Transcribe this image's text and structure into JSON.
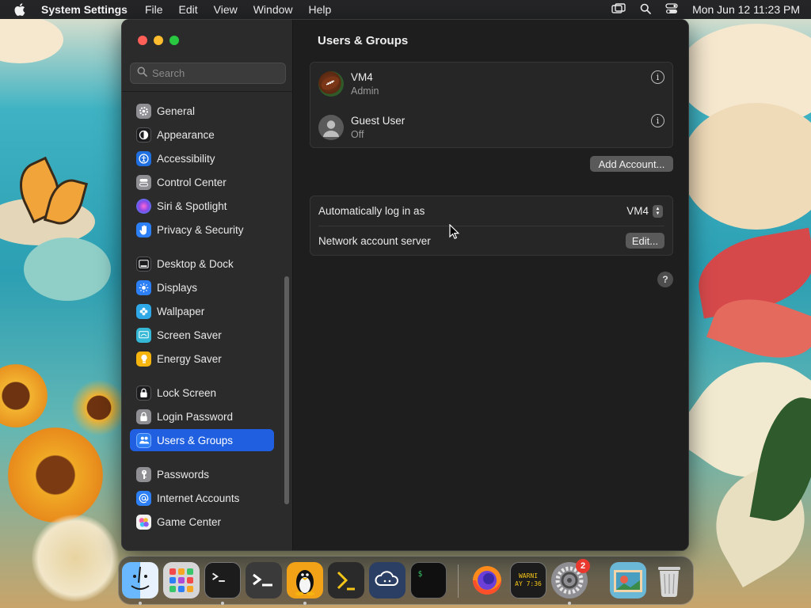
{
  "menubar": {
    "app_name": "System Settings",
    "menus": [
      "File",
      "Edit",
      "View",
      "Window",
      "Help"
    ],
    "clock": "Mon Jun 12  11:23 PM"
  },
  "sidebar": {
    "search_placeholder": "Search",
    "items": [
      {
        "label": "General",
        "icon": "gear-icon",
        "color": "#8e8e93"
      },
      {
        "label": "Appearance",
        "icon": "appearance-icon",
        "color": "#1c1c1e"
      },
      {
        "label": "Accessibility",
        "icon": "accessibility-icon",
        "color": "#1f6fe0"
      },
      {
        "label": "Control Center",
        "icon": "control-center-icon",
        "color": "#8e8e93"
      },
      {
        "label": "Siri & Spotlight",
        "icon": "siri-icon",
        "color": "#b04ad6"
      },
      {
        "label": "Privacy & Security",
        "icon": "hand-icon",
        "color": "#2d7ff5"
      },
      {
        "label": "Desktop & Dock",
        "icon": "dock-icon",
        "color": "#1c1c1e"
      },
      {
        "label": "Displays",
        "icon": "displays-icon",
        "color": "#2d7ff5"
      },
      {
        "label": "Wallpaper",
        "icon": "wallpaper-icon",
        "color": "#2fa8e8"
      },
      {
        "label": "Screen Saver",
        "icon": "screen-saver-icon",
        "color": "#35b7d6"
      },
      {
        "label": "Energy Saver",
        "icon": "battery-icon",
        "color": "#f5b50e"
      },
      {
        "label": "Lock Screen",
        "icon": "lock-icon",
        "color": "#1c1c1e"
      },
      {
        "label": "Login Password",
        "icon": "login-lock-icon",
        "color": "#8e8e93"
      },
      {
        "label": "Users & Groups",
        "icon": "users-icon",
        "color": "#2d7ff5",
        "active": true
      },
      {
        "label": "Passwords",
        "icon": "key-icon",
        "color": "#8e8e93"
      },
      {
        "label": "Internet Accounts",
        "icon": "at-icon",
        "color": "#2d7ff5"
      },
      {
        "label": "Game Center",
        "icon": "game-center-icon",
        "color": "#e8e8e8"
      }
    ]
  },
  "main": {
    "title": "Users & Groups",
    "users": [
      {
        "name": "VM4",
        "role": "Admin"
      },
      {
        "name": "Guest User",
        "role": "Off"
      }
    ],
    "add_account_label": "Add Account...",
    "auto_login_label": "Automatically log in as",
    "auto_login_value": "VM4",
    "network_server_label": "Network account server",
    "edit_label": "Edit..."
  },
  "dock": {
    "apps": [
      "Finder",
      "Launchpad",
      "Terminal",
      "Shell",
      "Tux",
      "Prompt",
      "Cloud",
      "Console",
      "Firefox",
      "Console Log",
      "System Settings",
      "Preview",
      "Trash"
    ],
    "console_warning_text": "WARNI\nAY 7:36",
    "settings_badge": "2"
  }
}
